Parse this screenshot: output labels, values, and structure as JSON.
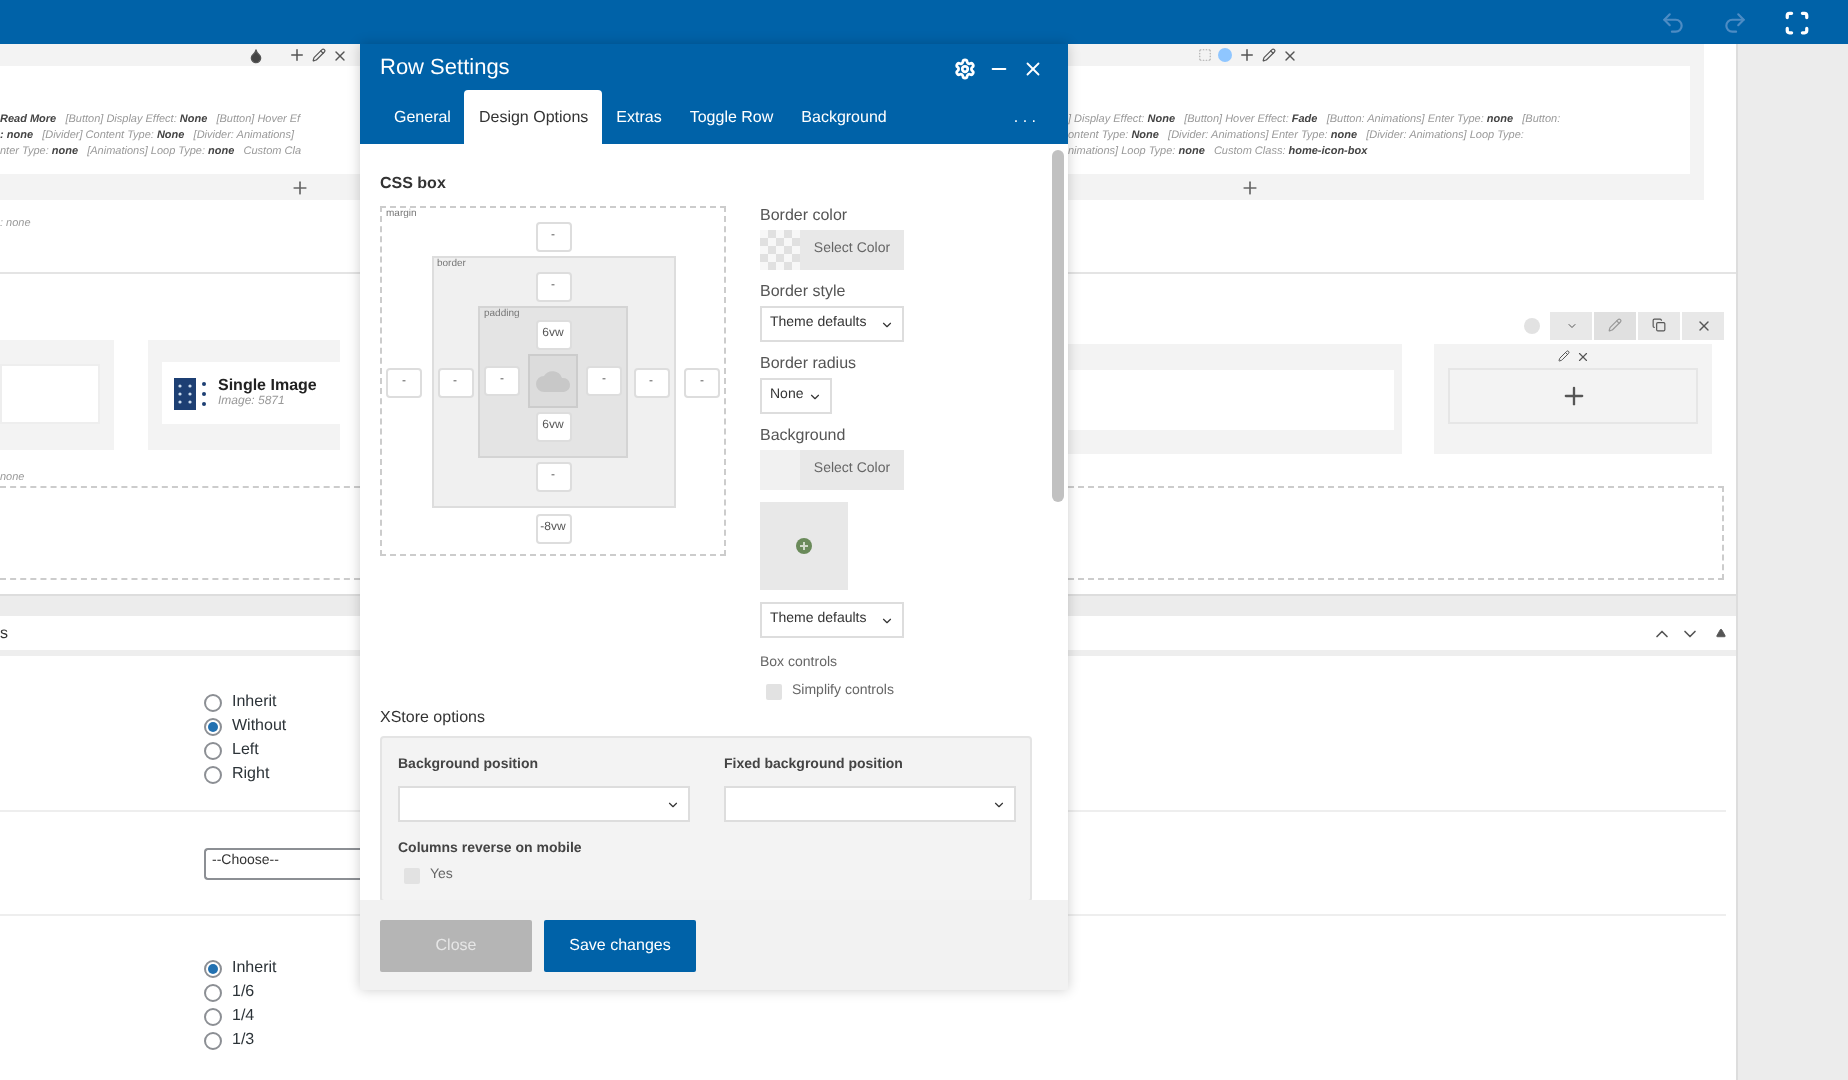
{
  "builder": {
    "top_section": {
      "left_lines": [
        "**Read More**   [Button] Display Effect: **None**   [Button] Hover Ef",
        "**: none**   [Divider] Content Type: **None**   [Divider: Animations]",
        "nter Type: **none**   [Animations] Loop Type: **none**   Custom Cla"
      ],
      "right_lines": [
        "] Display Effect: **None**   [Button] Hover Effect: **Fade**   [Button: Animations] Enter Type: **none**   [Button:",
        "ontent Type: **None**   [Divider: Animations] Enter Type: **none**   [Divider: Animations] Loop Type:",
        "nimations] Loop Type: **none**   Custom Class: **home-icon-box**"
      ]
    },
    "note_1": ": none",
    "single_image": {
      "title": "Single Image",
      "subtitle": "Image: 5871"
    },
    "note_2": "none",
    "panel_title": "s",
    "alignment_options": [
      {
        "label": "Inherit",
        "selected": false
      },
      {
        "label": "Without",
        "selected": true
      },
      {
        "label": "Left",
        "selected": false
      },
      {
        "label": "Right",
        "selected": false
      }
    ],
    "choose_select": {
      "value": "--Choose--"
    },
    "width_options": [
      {
        "label": "Inherit",
        "selected": true
      },
      {
        "label": "1/6",
        "selected": false
      },
      {
        "label": "1/4",
        "selected": false
      },
      {
        "label": "1/3",
        "selected": false
      }
    ]
  },
  "modal": {
    "title": "Row Settings",
    "tabs": [
      {
        "label": "General",
        "selected": false
      },
      {
        "label": "Design Options",
        "selected": true
      },
      {
        "label": "Extras",
        "selected": false
      },
      {
        "label": "Toggle Row",
        "selected": false
      },
      {
        "label": "Background",
        "selected": false
      }
    ],
    "more_tabs": ". . .",
    "css_box": {
      "title": "CSS box",
      "margin": {
        "label": "margin",
        "top": "-",
        "right": "-",
        "bottom": "-8vw",
        "left": "-"
      },
      "border": {
        "label": "border",
        "top": "-",
        "right": "-",
        "bottom": "-",
        "left": "-"
      },
      "padding": {
        "label": "padding",
        "top": "6vw",
        "right": "-",
        "bottom": "6vw",
        "left": "-"
      }
    },
    "border_color": {
      "label": "Border color",
      "button": "Select Color"
    },
    "border_style": {
      "label": "Border style",
      "value": "Theme defaults"
    },
    "border_radius": {
      "label": "Border radius",
      "value": "None"
    },
    "background": {
      "label": "Background",
      "button": "Select Color",
      "style_value": "Theme defaults"
    },
    "box_controls": {
      "label": "Box controls",
      "option": "Simplify controls",
      "checked": false
    },
    "xstore": {
      "title": "XStore options",
      "background_position": {
        "label": "Background position"
      },
      "fixed_background_position": {
        "label": "Fixed background position"
      },
      "columns_reverse": {
        "label": "Columns reverse on mobile",
        "option": "Yes",
        "checked": false
      }
    },
    "buttons": {
      "close": "Close",
      "save": "Save changes"
    }
  }
}
